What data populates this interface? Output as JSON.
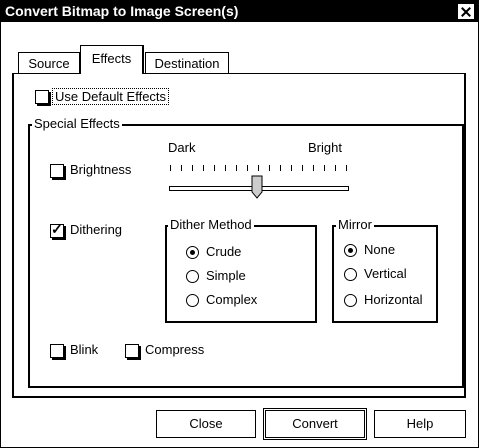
{
  "window": {
    "title": "Convert Bitmap to Image Screen(s)"
  },
  "tabs": [
    {
      "label": "Source"
    },
    {
      "label": "Effects"
    },
    {
      "label": "Destination"
    }
  ],
  "effects": {
    "use_default": {
      "label": "Use Default Effects",
      "checked": false
    },
    "special_effects_title": "Special Effects",
    "brightness": {
      "label": "Brightness",
      "checked": false,
      "dark_label": "Dark",
      "bright_label": "Bright",
      "level_fraction": 0.5
    },
    "dithering": {
      "label": "Dithering",
      "checked": true
    },
    "dither_method": {
      "title": "Dither Method",
      "options": [
        "Crude",
        "Simple",
        "Complex"
      ],
      "selected": "Crude"
    },
    "mirror": {
      "title": "Mirror",
      "options": [
        "None",
        "Vertical",
        "Horizontal"
      ],
      "selected": "None"
    },
    "blink": {
      "label": "Blink",
      "checked": false
    },
    "compress": {
      "label": "Compress",
      "checked": false
    }
  },
  "buttons": {
    "close": "Close",
    "convert": "Convert",
    "help": "Help"
  }
}
